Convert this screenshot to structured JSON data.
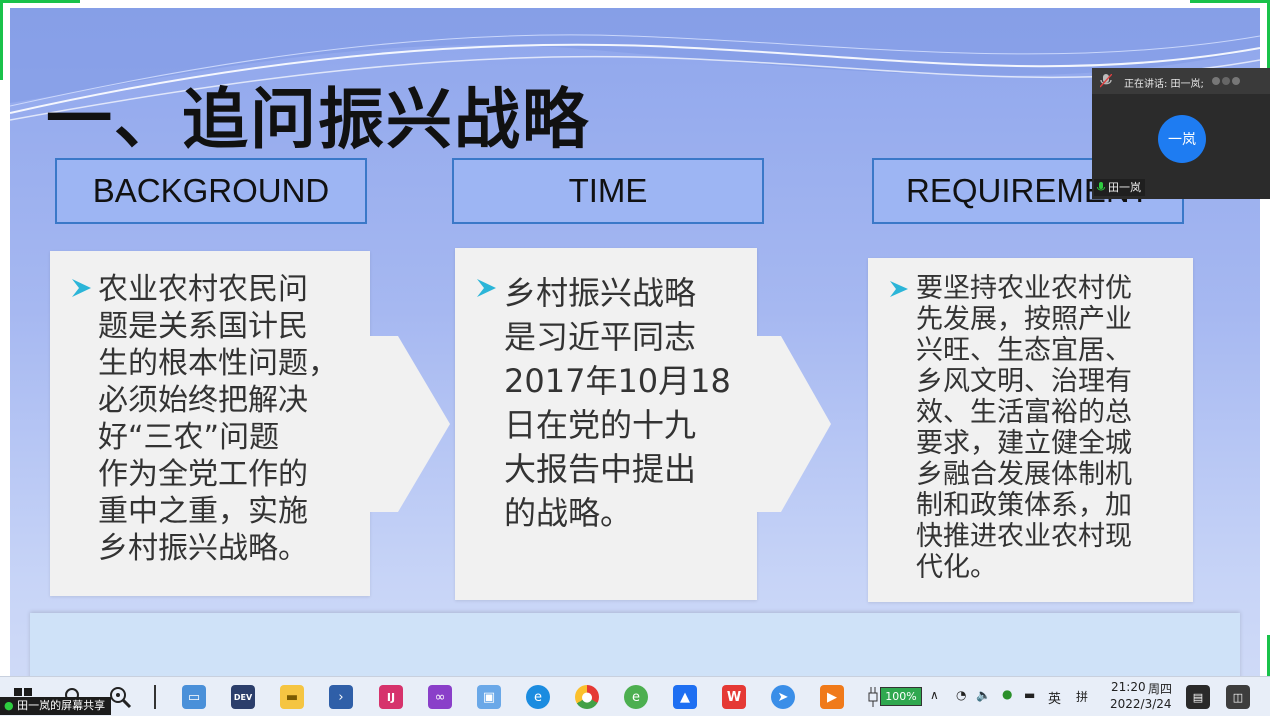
{
  "slide": {
    "title": "一、追问振兴战略",
    "headers": [
      "BACKGROUND",
      "TIME",
      "REQUIREMENT"
    ],
    "cards": [
      [
        "农业农村农民问",
        "题是关系国计民",
        "生的根本性问题，",
        "必须始终把解决",
        "好“三农”问题",
        "作为全党工作的",
        "重中之重，实施",
        "乡村振兴战略。"
      ],
      [
        "乡村振兴战略",
        "是习近平同志",
        "2017年10月18",
        "日在党的十九",
        "大报告中提出",
        "的战略。"
      ],
      [
        "要坚持农业农村优",
        "先发展，按照产业",
        "兴旺、生态宜居、",
        "乡风文明、治理有",
        "效、生活富裕的总",
        "要求，建立健全城",
        "乡融合发展体制机",
        "制和政策体系，加",
        "快推进农业农村现",
        "代化。"
      ]
    ],
    "bullet_color": "#2bb5d8"
  },
  "meeting": {
    "speaking_label": "正在讲话: 田一岚;",
    "avatar_text": "一岚",
    "participant_name": "田一岚"
  },
  "share_label": "田一岚的屏幕共享",
  "taskbar": {
    "icons": [
      "windows-start",
      "search",
      "zoom-app",
      "divider",
      "desktop-app",
      "devexpress-app",
      "file-explorer",
      "powershell",
      "jetbrains-app",
      "visual-studio",
      "remote-desktop",
      "edge-browser",
      "chrome-browser",
      "ie-browser",
      "lanhu-app",
      "wps-office",
      "feishu-app",
      "media-player"
    ],
    "battery": "100%",
    "ime": "英",
    "ime2": "拼",
    "time": "21:20",
    "weekday": "周四",
    "date": "2022/3/24"
  },
  "colors": {
    "accent": "#3a78c8",
    "share_border": "#19c24a",
    "avatar": "#1e7cf2"
  }
}
